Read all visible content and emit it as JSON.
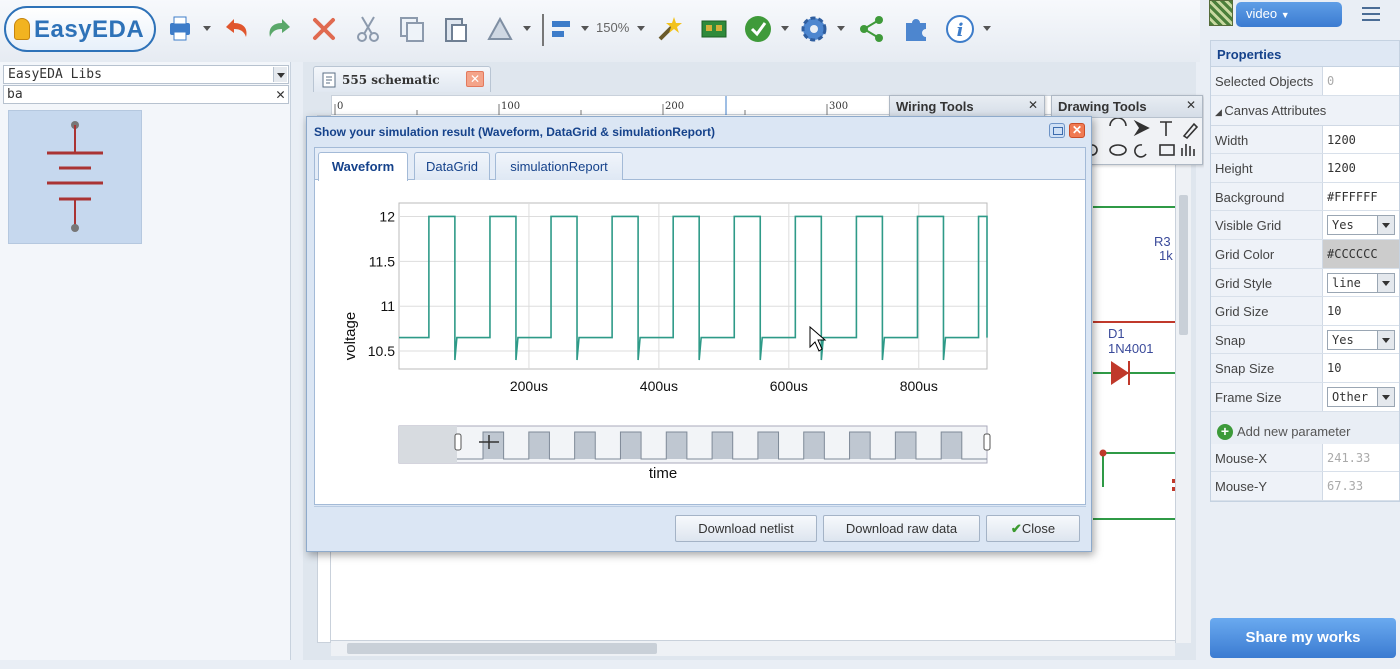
{
  "app": {
    "logo_text": "EasyEDA",
    "zoom_label": "150%"
  },
  "toolbar": {
    "icons": [
      "print-icon",
      "undo-icon",
      "redo-icon",
      "delete-icon",
      "cut-icon",
      "copy-icon",
      "paste-icon",
      "rotate-icon",
      "align-icon",
      "wand-icon",
      "pcb-icon",
      "simulate-icon",
      "gear-icon",
      "share-icon",
      "puzzle-icon",
      "info-icon"
    ]
  },
  "left_panel": {
    "library_select": "EasyEDA Libs",
    "search_value": "ba"
  },
  "document": {
    "tab_label": "555 schematic",
    "ruler_ticks": [
      "0",
      "100",
      "200",
      "300"
    ]
  },
  "palettes": {
    "wiring_title": "Wiring Tools",
    "drawing_title": "Drawing Tools"
  },
  "schematic": {
    "r3_label": "R3",
    "r3_value": "1k",
    "d1_label": "D1",
    "d1_value": "1N4001"
  },
  "dialog": {
    "title": "Show your simulation result (Waveform, DataGrid & simulationReport)",
    "tabs": [
      "Waveform",
      "DataGrid",
      "simulationReport"
    ],
    "active_tab": "Waveform",
    "buttons": {
      "download_netlist": "Download netlist",
      "download_raw": "Download raw data",
      "close": "Close"
    }
  },
  "chart_data": {
    "type": "line",
    "title": "",
    "xlabel": "time",
    "ylabel": "voltage",
    "x_ticks": [
      "200us",
      "400us",
      "600us",
      "800us"
    ],
    "y_ticks": [
      "12",
      "11.5",
      "11",
      "10.5"
    ],
    "xlim_us": [
      0,
      905
    ],
    "ylim": [
      10.3,
      12.15
    ],
    "grid": true,
    "series": [
      {
        "name": "",
        "color": "#2e9a88",
        "shape": "square",
        "low": 10.65,
        "high": 12.0,
        "period_us": 94,
        "first_rise_us": 46,
        "high_duration_us": 40,
        "spike_min": 10.4
      }
    ],
    "navigator": {
      "pulse_count": 11
    }
  },
  "right_panel": {
    "video_label": "video",
    "properties_title": "Properties",
    "selected_objects_label": "Selected Objects",
    "selected_objects_value": "0",
    "canvas_attributes_label": "Canvas Attributes",
    "attributes": [
      {
        "key": "Width",
        "value": "1200",
        "kind": "text"
      },
      {
        "key": "Height",
        "value": "1200",
        "kind": "text"
      },
      {
        "key": "Background",
        "value": "#FFFFFF",
        "kind": "text"
      },
      {
        "key": "Visible Grid",
        "value": "Yes",
        "kind": "select"
      },
      {
        "key": "Grid Color",
        "value": "#CCCCCC",
        "kind": "swatch"
      },
      {
        "key": "Grid Style",
        "value": "line",
        "kind": "select"
      },
      {
        "key": "Grid Size",
        "value": "10",
        "kind": "text"
      },
      {
        "key": "Snap",
        "value": "Yes",
        "kind": "select"
      },
      {
        "key": "Snap Size",
        "value": "10",
        "kind": "text"
      },
      {
        "key": "Frame Size",
        "value": "Other",
        "kind": "select"
      }
    ],
    "add_parameter": "Add new parameter",
    "mouse_x_label": "Mouse-X",
    "mouse_x_value": "241.33",
    "mouse_y_label": "Mouse-Y",
    "mouse_y_value": "67.33",
    "share_label": "Share my works"
  }
}
